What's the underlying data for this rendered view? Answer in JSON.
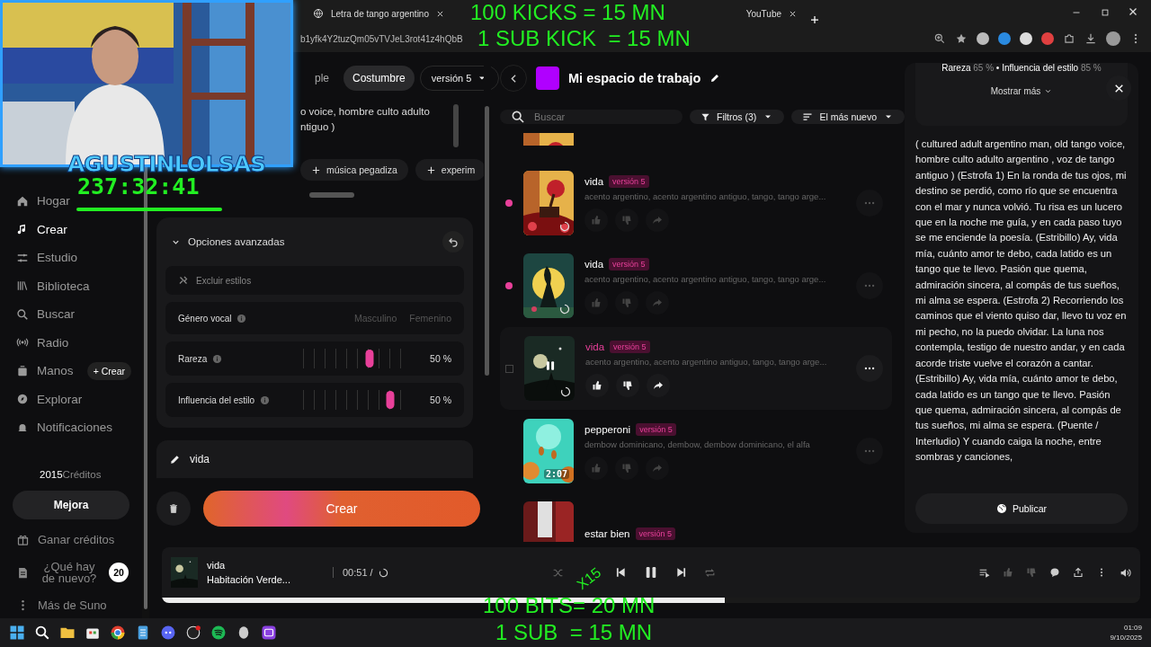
{
  "browser": {
    "tabs": [
      {
        "title": "Letra de tango argentino",
        "selected": false
      },
      {
        "title": "YouTube",
        "selected": false
      }
    ],
    "url": "b1yfk4Y2tuzQm05vTVJeL3rot41z4hQbB"
  },
  "stream_overlay": {
    "channel": "AGUSTINLOLSAS",
    "timer": "237:32:41",
    "top_texts": [
      "100 KICKS = 15 MN",
      "1 SUB KICK  = 15 MN"
    ],
    "bottom_texts": [
      "100 BITS= 20 MN",
      "1 SUB  = 15 MN"
    ],
    "multiplier": "X15"
  },
  "sidebar": {
    "items": [
      {
        "label": "Hogar",
        "selected": false
      },
      {
        "label": "Crear",
        "selected": true
      },
      {
        "label": "Estudio",
        "selected": false
      },
      {
        "label": "Biblioteca",
        "selected": false
      },
      {
        "label": "Buscar",
        "selected": false
      },
      {
        "label": "Radio",
        "selected": false
      },
      {
        "label": "Manos",
        "selected": false,
        "action": "+ Crear"
      },
      {
        "label": "Explorar",
        "selected": false
      },
      {
        "label": "Notificaciones",
        "selected": false
      }
    ],
    "credits": "2015",
    "credits_label": "Créditos",
    "upgrade": "Mejora",
    "footer": [
      {
        "label": "Ganar créditos"
      },
      {
        "label": "¿Qué hay de nuevo?",
        "badge": "20"
      },
      {
        "label": "Más de Suno"
      }
    ]
  },
  "create": {
    "modes": [
      {
        "label": "ple",
        "selected": false
      },
      {
        "label": "Costumbre",
        "selected": true
      }
    ],
    "model": "versión 5",
    "style_lines": [
      "o voice, hombre culto adulto",
      "ntiguo )"
    ],
    "chips": [
      "música pegadiza",
      "experim"
    ],
    "advanced": {
      "title": "Opciones avanzadas",
      "expanded": true,
      "exclude_placeholder": "Excluir estilos",
      "vocal": {
        "label": "Género vocal",
        "options": [
          {
            "label": "Masculino",
            "selected": false
          },
          {
            "label": "Femenino",
            "selected": false
          }
        ]
      },
      "sliders": [
        {
          "label": "Rareza",
          "level": 0.65,
          "reading": "50 %"
        },
        {
          "label": "Influencia del estilo",
          "level": 0.83,
          "reading": "50 %"
        }
      ]
    },
    "title_value": "vida",
    "create_button": "Crear"
  },
  "workspace": {
    "title": "Mi espacio de trabajo",
    "search_placeholder": "Buscar",
    "filter": "Filtros",
    "filter_count": "(3)",
    "sort": "El más nuevo",
    "songs": [
      {
        "title": "vida",
        "version": "versión 5",
        "tags": "acento argentino, acento argentino antiguo, tango, tango arge...",
        "new": true,
        "playing": false,
        "loading": true
      },
      {
        "title": "vida",
        "version": "versión 5",
        "tags": "acento argentino, acento argentino antiguo, tango, tango arge...",
        "new": true,
        "playing": false,
        "loading": true
      },
      {
        "title": "vida",
        "version": "versión 5",
        "tags": "acento argentino, acento argentino antiguo, tango, tango arge...",
        "new": false,
        "playing": true,
        "loading": true
      },
      {
        "title": "pepperoni",
        "version": "versión 5",
        "tags": "dembow dominicano, dembow, dembow dominicano, el alfa",
        "new": false,
        "playing": false,
        "duration": "2:07"
      },
      {
        "title": "estar bien",
        "version": "versión 5",
        "new": false,
        "playing": false
      }
    ]
  },
  "details": {
    "separator": "•",
    "stats": [
      {
        "label": "Rareza",
        "value": "65 %"
      },
      {
        "label": "Influencia del estilo",
        "value": "85 %"
      }
    ],
    "more": "Mostrar más",
    "lyrics": "( cultured adult argentino man, old tango voice, hombre culto adulto argentino , voz de tango antiguo ) (Estrofa 1) En la ronda de tus ojos, mi destino se perdió, como río que se encuentra con el mar y nunca volvió. Tu risa es un lucero que en la noche me guía, y en cada paso tuyo se me enciende la poesía. (Estribillo) Ay, vida mía, cuánto amor te debo, cada latido es un tango que te llevo. Pasión que quema, admiración sincera, al compás de tus sueños, mi alma se espera. (Estrofa 2) Recorriendo los caminos que el viento quiso dar, llevo tu voz en mi pecho, no la puedo olvidar. La luna nos contempla, testigo de nuestro andar, y en cada acorde triste vuelve el corazón a cantar. (Estribillo) Ay, vida mía, cuánto amor te debo, cada latido es un tango que te llevo. Pasión que quema, admiración sincera, al compás de tus sueños, mi alma se espera. (Puente / Interludio) Y cuando caiga la noche, entre sombras y canciones,",
    "publish": "Publicar"
  },
  "player": {
    "title": "vida",
    "artist": "Habitación Verde...",
    "time": "00:51 /",
    "level": 0.575
  },
  "taskbar": {
    "time": "01:09",
    "date": "9/10/2025"
  }
}
